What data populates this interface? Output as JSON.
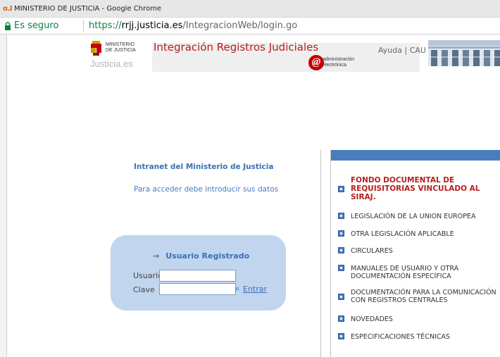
{
  "window": {
    "title": "MINISTERIO DE JUSTICIA - Google Chrome",
    "secure_label": "Es seguro",
    "url_scheme": "https://",
    "url_host": "rrjj.justicia.es",
    "url_path": "/IntegracionWeb/login.go"
  },
  "header": {
    "ministry_logo_text": "MINISTERIO\nDE JUSTICIA",
    "justicia_label": "Justicia.es",
    "site_title": "Integración Registros Judiciales",
    "ae_logo_mark": "@",
    "ae_logo_text": "administración\nelectrónica",
    "links": {
      "help": "Ayuda",
      "separator": "|",
      "cau": "CAU"
    }
  },
  "login": {
    "intranet_title": "Intranet del Ministerio de Justicia",
    "instructions": "Para acceder debe introducir sus datos",
    "box_title": "Usuario Registrado",
    "user_label": "Usuario",
    "user_value": "",
    "password_label": "Clave",
    "password_value": "",
    "enter_label": "Entrar"
  },
  "documents": {
    "items": [
      {
        "label": "FONDO DOCUMENTAL DE\nREQUISITORIAS VINCULADO AL\nSIRAJ.",
        "featured": true
      },
      {
        "label": "LEGISLACIÓN DE LA UNION EUROPEA",
        "featured": false
      },
      {
        "label": "OTRA LEGISLACIÓN APLICABLE",
        "featured": false
      },
      {
        "label": "CIRCULARES",
        "featured": false
      },
      {
        "label": "MANUALES DE USUARIO Y OTRA\nDOCUMENTACIÓN ESPECÍFICA",
        "featured": false
      },
      {
        "label": "DOCUMENTACIÓN PARA LA COMUNICACIÓN\nCON REGISTROS CENTRALES",
        "featured": false
      },
      {
        "label": "NOVEDADES",
        "featured": false
      },
      {
        "label": "ESPECIFICACIONES TÉCNICAS",
        "featured": false
      }
    ]
  },
  "colors": {
    "accent_blue": "#4a7cc0",
    "title_red": "#b51f1f",
    "login_box": "#c2d5ee",
    "secure_green": "#0b8043"
  },
  "icons": [
    "chrome-favicon-icon",
    "lock-icon",
    "ministry-shield-icon",
    "arrow-right-icon",
    "enter-icon",
    "list-bullet-icon"
  ]
}
